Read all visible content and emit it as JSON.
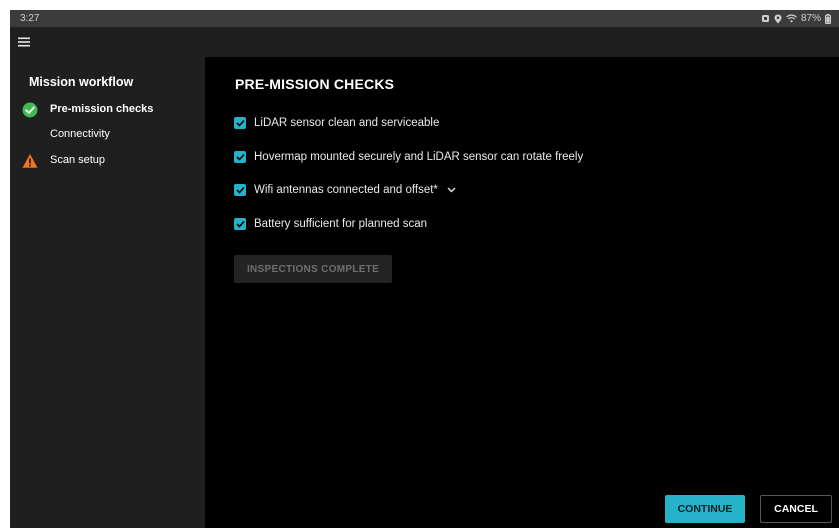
{
  "status_bar": {
    "time": "3:27",
    "battery": "87%",
    "icons": [
      "notification-icon",
      "location-icon",
      "wifi-icon",
      "battery-icon"
    ]
  },
  "app_bar": {
    "menu_icon": "hamburger-menu-icon"
  },
  "sidebar": {
    "title": "Mission workflow",
    "steps": [
      {
        "label": "Pre-mission checks",
        "status": "complete",
        "icon": "check-circle-icon",
        "color": "#3fb950",
        "active": true
      },
      {
        "label": "Connectivity",
        "status": "none",
        "icon": "",
        "active": false
      },
      {
        "label": "Scan setup",
        "status": "warning",
        "icon": "warning-triangle-icon",
        "color": "#f5731a",
        "active": false
      }
    ]
  },
  "main": {
    "heading": "PRE-MISSION CHECKS",
    "checks": [
      {
        "label": "LiDAR sensor clean and serviceable",
        "checked": true
      },
      {
        "label": "Hovermap mounted securely and LiDAR sensor can rotate freely",
        "checked": true
      },
      {
        "label": "Wifi antennas connected and offset*",
        "checked": true,
        "expandable": true
      },
      {
        "label": "Battery sufficient for planned scan",
        "checked": true
      }
    ],
    "inspections_button": "INSPECTIONS COMPLETE",
    "inspections_enabled": false
  },
  "footer": {
    "continue_label": "CONTINUE",
    "cancel_label": "CANCEL"
  },
  "colors": {
    "accent": "#26b2c8",
    "sidebar_bg": "#1f1f1f",
    "main_bg": "#000000",
    "success": "#3fb950",
    "warning": "#f5731a"
  }
}
